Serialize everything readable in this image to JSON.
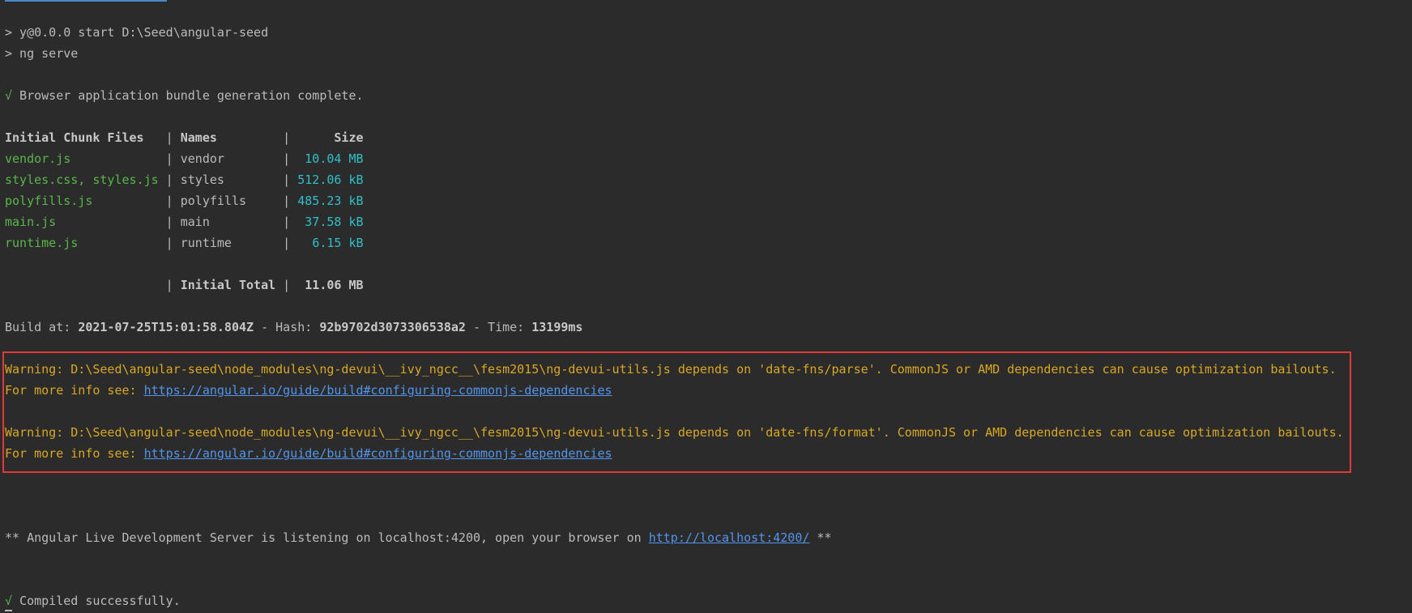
{
  "command": {
    "line1": "> y@0.0.0 start D:\\Seed\\angular-seed",
    "line2": "> ng serve"
  },
  "bundle_status": {
    "check": "√",
    "text": " Browser application bundle generation complete."
  },
  "chunk_table": {
    "header": {
      "files": "Initial Chunk Files",
      "names": "Names",
      "size": "Size"
    },
    "rows": [
      {
        "file": "vendor.js",
        "name": "vendor",
        "size": "10.04 MB"
      },
      {
        "file": "styles.css, styles.js",
        "name": "styles",
        "size": "512.06 kB"
      },
      {
        "file": "polyfills.js",
        "name": "polyfills",
        "size": "485.23 kB"
      },
      {
        "file": "main.js",
        "name": "main",
        "size": "37.58 kB"
      },
      {
        "file": "runtime.js",
        "name": "runtime",
        "size": "6.15 kB"
      }
    ],
    "total": {
      "label": "Initial Total",
      "size": "11.06 MB"
    }
  },
  "build_info": {
    "build_label": "Build at: ",
    "build_time": "2021-07-25T15:01:58.804Z",
    "hash_label": " - Hash: ",
    "hash": "92b9702d3073306538a2",
    "time_label": " - Time: ",
    "time": "13199ms"
  },
  "warnings": [
    {
      "text": "Warning: D:\\Seed\\angular-seed\\node_modules\\ng-devui\\__ivy_ngcc__\\fesm2015\\ng-devui-utils.js depends on 'date-fns/parse'. CommonJS or AMD dependencies can cause optimization bailouts.",
      "info_label": "For more info see: ",
      "info_link": "https://angular.io/guide/build#configuring-commonjs-dependencies"
    },
    {
      "text": "Warning: D:\\Seed\\angular-seed\\node_modules\\ng-devui\\__ivy_ngcc__\\fesm2015\\ng-devui-utils.js depends on 'date-fns/format'. CommonJS or AMD dependencies can cause optimization bailouts.",
      "info_label": "For more info see: ",
      "info_link": "https://angular.io/guide/build#configuring-commonjs-dependencies"
    }
  ],
  "server": {
    "prefix": "** Angular Live Development Server is listening on localhost:4200, open your browser on ",
    "link": "http://localhost:4200/",
    "suffix": " **"
  },
  "compiled": {
    "check": "√",
    "text": " Compiled successfully."
  },
  "colors": {
    "background": "#2b2b2b",
    "text": "#bbbbbb",
    "green": "#59b64b",
    "cyan": "#2fc0c8",
    "warning": "#d9a822",
    "link": "#5394ec",
    "highlight_box": "#e0393b"
  }
}
